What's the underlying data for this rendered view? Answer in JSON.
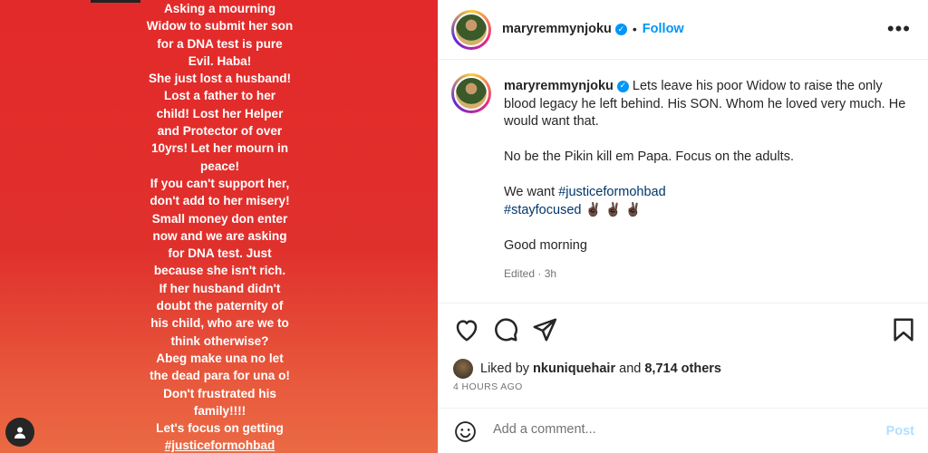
{
  "media": {
    "story_lines": [
      "Asking a mourning",
      "Widow to submit her son",
      "for a DNA test is pure",
      "Evil. Haba!",
      "She just lost a husband!",
      "Lost a father to her",
      "child! Lost her Helper",
      "and Protector of over",
      "10yrs! Let her mourn in",
      "peace!",
      "If you can't support her,",
      "don't add to her misery!",
      "Small money don enter",
      "now and we are asking",
      "for DNA test. Just",
      "because she isn't rich.",
      "If her husband didn't",
      "doubt the paternity of",
      "his child, who are we to",
      "think otherwise?",
      "Abeg make una no let",
      "the dead para for una o!",
      "Don't frustrated his",
      "family!!!!",
      "Let's focus on getting",
      "#justiceformohbad"
    ],
    "background_color": "#e32a2a",
    "tag_icon": "user-tag-icon"
  },
  "header": {
    "username": "maryremmynjoku",
    "separator": "•",
    "follow_label": "Follow",
    "more_icon": "more-options-icon"
  },
  "caption": {
    "username": "maryremmynjoku",
    "text_1": "Lets leave his poor Widow to raise the only blood legacy he left behind. His SON. Whom he loved very much. He would want that.",
    "text_2": "No be the Pikin kill em Papa. Focus on the adults.",
    "text_3_prefix": "We want",
    "hashtag_1": "#justiceformohbad",
    "hashtag_2": "#stayfocused",
    "emojis": "✌🏿 ✌🏿 ✌🏿",
    "text_4": "Good morning",
    "meta": "Edited · 3h"
  },
  "actions": {
    "like_icon": "heart-icon",
    "comment_icon": "comment-icon",
    "share_icon": "share-icon",
    "save_icon": "bookmark-icon"
  },
  "likes": {
    "prefix": "Liked by",
    "user": "nkuniquehair",
    "middle": "and",
    "others": "8,714 others"
  },
  "timestamp": "4 HOURS AGO",
  "comment": {
    "placeholder": "Add a comment...",
    "post_label": "Post",
    "emoji_icon": "emoji-icon"
  },
  "colors": {
    "accent": "#0095f6",
    "link": "#00376b",
    "muted": "#737373"
  }
}
